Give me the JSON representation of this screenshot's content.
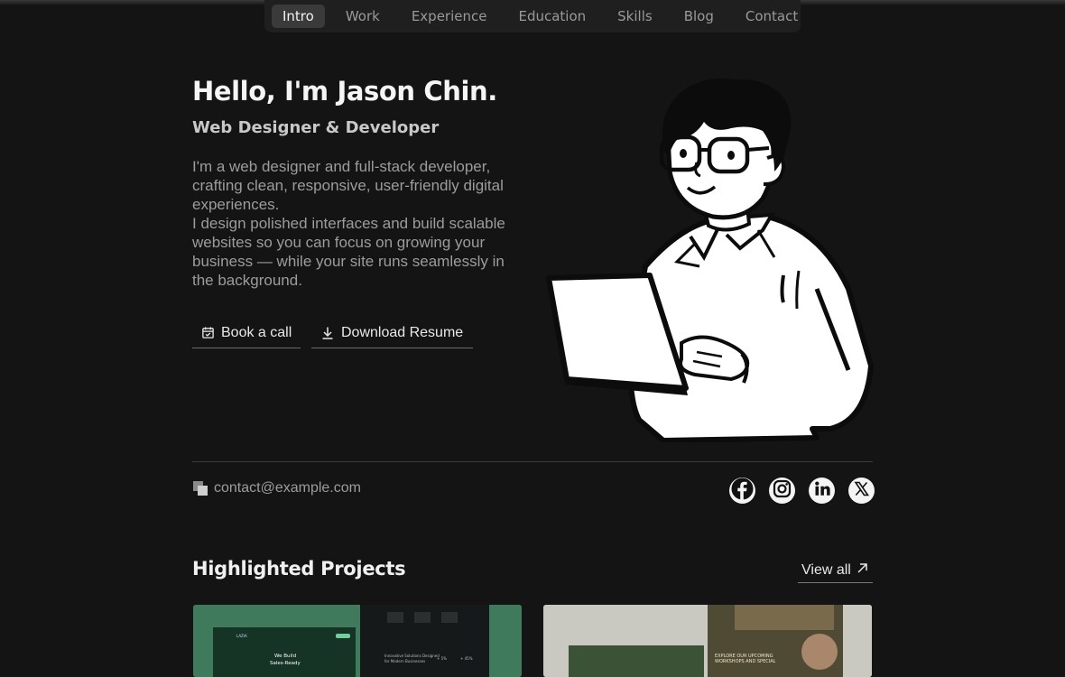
{
  "nav": {
    "items": [
      "Intro",
      "Work",
      "Experience",
      "Education",
      "Skills",
      "Blog",
      "Contact"
    ],
    "active": "Intro"
  },
  "hero": {
    "title": "Hello, I'm Jason Chin.",
    "subtitle": "Web Designer & Developer",
    "description": [
      "I'm a web designer and full-stack developer, crafting clean, responsive, user-friendly digital experiences.",
      "I design polished interfaces and build scalable websites so you can focus on growing your business — while your site runs seamlessly in the background."
    ],
    "buttons": {
      "book_call": "Book a call",
      "download_resume": "Download Resume"
    }
  },
  "contact": {
    "email": "contact@example.com"
  },
  "socials": [
    {
      "name": "facebook",
      "icon": "facebook-icon"
    },
    {
      "name": "instagram",
      "icon": "instagram-icon"
    },
    {
      "name": "linkedin",
      "icon": "linkedin-icon"
    },
    {
      "name": "x",
      "icon": "x-icon"
    }
  ],
  "projects": {
    "title": "Highlighted Projects",
    "view_all": "View all",
    "cards": [
      {
        "name": "project-1",
        "text": [
          "We Build",
          "Sales-Ready",
          "Innovative Solutions Designed",
          "for Modern Businesses",
          "+ 5%",
          "+ 45%"
        ]
      },
      {
        "name": "project-2",
        "text": [
          "EXPLORE OUR UPCOMING",
          "WORKSHOPS AND SPECIAL"
        ]
      }
    ]
  },
  "colors": {
    "background": "#141414",
    "nav_bg": "#1f1f1f",
    "nav_active_bg": "#3a3a3a",
    "text_primary": "#f5f5f5",
    "text_muted": "#9c9c9c",
    "card1_bg": "#3f7a5c",
    "card2_bg": "#cfcfc8"
  }
}
